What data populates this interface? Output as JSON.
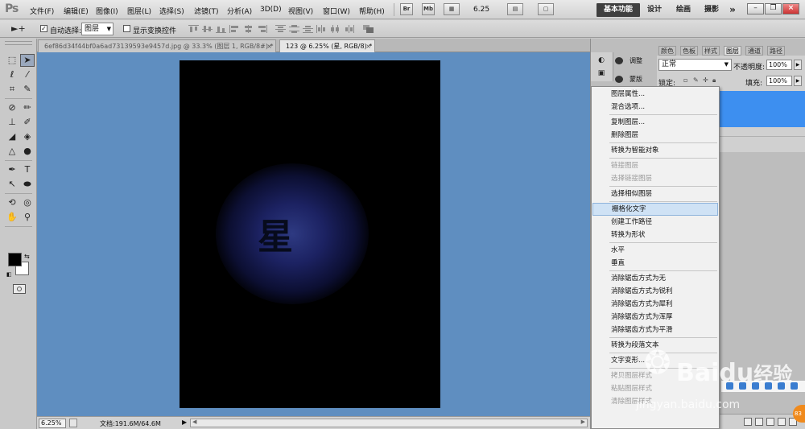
{
  "app": {
    "logo": "Ps",
    "menu": [
      "文件(F)",
      "编辑(E)",
      "图像(I)",
      "图层(L)",
      "选择(S)",
      "滤镜(T)",
      "分析(A)",
      "3D(D)",
      "视图(V)",
      "窗口(W)",
      "帮助(H)"
    ],
    "menubar_icons": [
      "Br",
      "Mb"
    ],
    "zoom": "6.25",
    "workspaces": [
      "基本功能",
      "设计",
      "绘画",
      "摄影"
    ],
    "more": "»"
  },
  "options": {
    "tool_glyph": "►+",
    "auto_select_label": "自动选择:",
    "auto_select_checked": true,
    "auto_select_target": "图层",
    "show_transform_label": "显示变换控件",
    "show_transform_checked": false
  },
  "tabs": [
    {
      "label": "6ef86d34f44bf0a6ad73139593e9457d.jpg @ 33.3% (图层 1, RGB/8#) *",
      "active": false
    },
    {
      "label": "123 @ 6.25% (星, RGB/8) *",
      "active": true
    }
  ],
  "canvas": {
    "text_layer": "星",
    "background_color": "#5f8ec0",
    "document_color": "#000000",
    "glow_color": "#2e3a82"
  },
  "status": {
    "zoom": "6.25%",
    "doc_info": "文档:191.6M/64.6M"
  },
  "dock": {
    "adjust_label": "调整",
    "mask_label": "蒙版",
    "panel_tabs": [
      "颜色",
      "色板",
      "样式",
      "图层",
      "通道",
      "路径"
    ],
    "active_panel": "图层",
    "blend_mode": "正常",
    "opacity_label": "不透明度:",
    "opacity": "100%",
    "lock_label": "锁定:",
    "fill_label": "填充:",
    "fill": "100%",
    "selected_layer_color": "#3d8ff0"
  },
  "context_menu": {
    "items": [
      {
        "label": "图层属性...",
        "disabled": false
      },
      {
        "label": "混合选项...",
        "disabled": false
      },
      {
        "sep": true
      },
      {
        "label": "复制图层...",
        "disabled": false
      },
      {
        "label": "删除图层",
        "disabled": false
      },
      {
        "sep": true
      },
      {
        "label": "转换为智能对象",
        "disabled": false
      },
      {
        "sep": true
      },
      {
        "label": "链接图层",
        "disabled": true
      },
      {
        "label": "选择链接图层",
        "disabled": true
      },
      {
        "sep": true
      },
      {
        "label": "选择相似图层",
        "disabled": false
      },
      {
        "sep": true
      },
      {
        "label": "栅格化文字",
        "disabled": false,
        "hover": true
      },
      {
        "label": "创建工作路径",
        "disabled": false
      },
      {
        "label": "转换为形状",
        "disabled": false
      },
      {
        "sep": true
      },
      {
        "label": "水平",
        "disabled": false
      },
      {
        "label": "垂直",
        "disabled": false
      },
      {
        "sep": true
      },
      {
        "label": "消除锯齿方式为无",
        "disabled": false
      },
      {
        "label": "消除锯齿方式为锐利",
        "disabled": false
      },
      {
        "label": "消除锯齿方式为犀利",
        "disabled": false
      },
      {
        "label": "消除锯齿方式为浑厚",
        "disabled": false
      },
      {
        "label": "消除锯齿方式为平滑",
        "disabled": false
      },
      {
        "sep": true
      },
      {
        "label": "转换为段落文本",
        "disabled": false
      },
      {
        "sep": true
      },
      {
        "label": "文字变形...",
        "disabled": false
      },
      {
        "sep": true
      },
      {
        "label": "拷贝图层样式",
        "disabled": true
      },
      {
        "label": "粘贴图层样式",
        "disabled": true
      },
      {
        "label": "清除图层样式",
        "disabled": true
      }
    ]
  },
  "watermark": {
    "brand": "Bai",
    "brand2": "du",
    "suffix": "经验",
    "url": "jingyan.baidu.com"
  },
  "badge": "83"
}
